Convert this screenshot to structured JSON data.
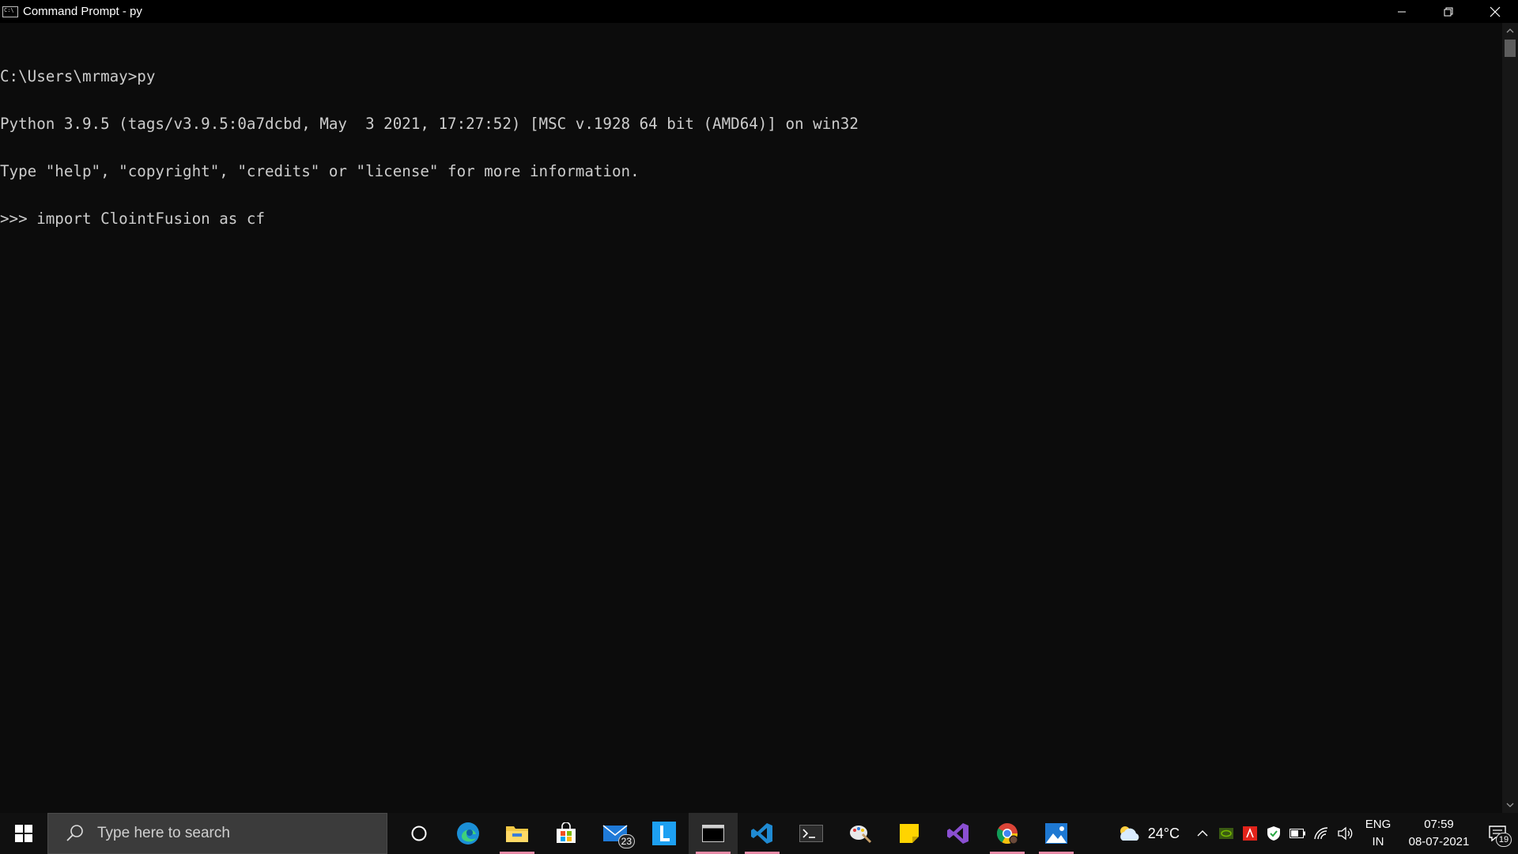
{
  "window": {
    "title": "Command Prompt - py"
  },
  "console": {
    "lines": [
      "C:\\Users\\mrmay>py",
      "Python 3.9.5 (tags/v3.9.5:0a7dcbd, May  3 2021, 17:27:52) [MSC v.1928 64 bit (AMD64)] on win32",
      "Type \"help\", \"copyright\", \"credits\" or \"license\" for more information.",
      ">>> import ClointFusion as cf"
    ],
    "background": "#0c0c0c",
    "foreground": "#cccccc"
  },
  "taskbar": {
    "search_placeholder": "Type here to search",
    "mail_badge": "23",
    "weather_temp": "24°C",
    "lang_line1": "ENG",
    "lang_line2": "IN",
    "time": "07:59",
    "date": "08-07-2021",
    "notification_count": "19",
    "accent_underline": "#e58aa6",
    "apps": [
      "cortana-icon",
      "edge-icon",
      "file-explorer-icon",
      "store-icon",
      "mail-icon",
      "l-app-icon",
      "command-prompt-icon",
      "vscode-icon",
      "terminal-icon",
      "paint-icon",
      "sticky-notes-icon",
      "visual-studio-icon",
      "chrome-icon",
      "photos-icon"
    ]
  }
}
